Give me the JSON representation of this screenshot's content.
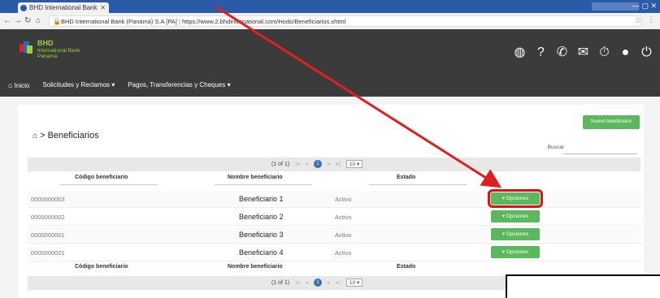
{
  "browser": {
    "tab_title": "BHD International Bank",
    "url_secure_label": "BHD International Bank (Panamá) S.A [PA]",
    "url_text": "https://www.2.bhdinternational.com/Hodo/Beneficiarios.xhtml"
  },
  "header": {
    "brand": "BHD",
    "brand_sub_1": "International Bank",
    "brand_sub_2": "Panamá",
    "nav": {
      "home_label": "Inicio",
      "solicitudes_label": "Solicitudes y Reclamos ▾",
      "pagos_label": "Pagos, Transferencias y Cheques ▾"
    }
  },
  "page": {
    "breadcrumb": "Beneficiarios",
    "new_button": "Nuevo beneficiario",
    "search_label": "Buscar",
    "pager": {
      "page_info": "(1 of 1)",
      "current_page": "1",
      "rows_per_page": "10 ▾"
    },
    "columns": {
      "code": "Código beneficiario",
      "name": "Nombre beneficiario",
      "state": "Estado"
    },
    "rows": [
      {
        "code": "0000000003",
        "name": "Beneficiario 1",
        "state": "Activo",
        "action": "Opciones"
      },
      {
        "code": "0000000002",
        "name": "Beneficiario 2",
        "state": "Activo",
        "action": "Opciones"
      },
      {
        "code": "0000000001",
        "name": "Beneficiario 3",
        "state": "Activo",
        "action": "Opciones"
      },
      {
        "code": "0000000001",
        "name": "Beneficiario 4",
        "state": "Activo",
        "action": "Opciones"
      }
    ]
  },
  "colors": {
    "header_bg": "#3b3b3b",
    "brand_green": "#9bd13c",
    "button_green": "#5cb85c",
    "highlight_red": "#d11111",
    "pager_blue": "#3a6fb0"
  }
}
